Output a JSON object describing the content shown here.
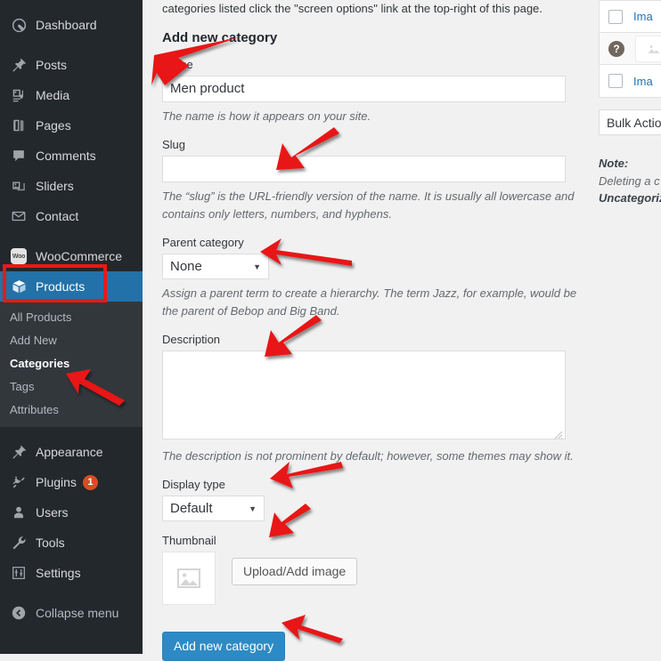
{
  "sidebar": {
    "items": [
      {
        "label": "Dashboard",
        "icon": "dashboard-icon",
        "name": "dashboard"
      },
      {
        "label": "Posts",
        "icon": "pin-icon",
        "name": "posts"
      },
      {
        "label": "Media",
        "icon": "media-icon",
        "name": "media"
      },
      {
        "label": "Pages",
        "icon": "pages-icon",
        "name": "pages"
      },
      {
        "label": "Comments",
        "icon": "comment-icon",
        "name": "comments"
      },
      {
        "label": "Sliders",
        "icon": "sliders-icon",
        "name": "sliders"
      },
      {
        "label": "Contact",
        "icon": "envelope-icon",
        "name": "contact"
      },
      {
        "label": "WooCommerce",
        "icon": "woocommerce-icon",
        "name": "woocommerce"
      },
      {
        "label": "Products",
        "icon": "product-box-icon",
        "name": "products",
        "current": true
      },
      {
        "label": "Appearance",
        "icon": "brush-icon",
        "name": "appearance"
      },
      {
        "label": "Plugins",
        "icon": "plug-icon",
        "name": "plugins",
        "badge": "1"
      },
      {
        "label": "Users",
        "icon": "user-icon",
        "name": "users"
      },
      {
        "label": "Tools",
        "icon": "wrench-icon",
        "name": "tools"
      },
      {
        "label": "Settings",
        "icon": "settings-sliders-icon",
        "name": "settings"
      },
      {
        "label": "Collapse menu",
        "icon": "collapse-arrow-icon",
        "name": "collapse-menu"
      }
    ],
    "submenu": [
      {
        "label": "All Products",
        "active": false
      },
      {
        "label": "Add New",
        "active": false
      },
      {
        "label": "Categories",
        "active": true
      },
      {
        "label": "Tags",
        "active": false
      },
      {
        "label": "Attributes",
        "active": false
      }
    ],
    "woo_badge_text": "Woo",
    "plugins_badge": "1"
  },
  "main": {
    "intro": "categories listed click the \"screen options\" link at the top-right of this page.",
    "form_title": "Add new category",
    "fields": {
      "name": {
        "label": "Name",
        "value": "Men product",
        "description": "The name is how it appears on your site."
      },
      "slug": {
        "label": "Slug",
        "value": "",
        "description": "The “slug” is the URL-friendly version of the name. It is usually all lowercase and contains only letters, numbers, and hyphens."
      },
      "parent": {
        "label": "Parent category",
        "value": "None",
        "options": [
          "None"
        ],
        "description": "Assign a parent term to create a hierarchy. The term Jazz, for example, would be the parent of Bebop and Big Band."
      },
      "description": {
        "label": "Description",
        "value": "",
        "description": "The description is not prominent by default; however, some themes may show it."
      },
      "display_type": {
        "label": "Display type",
        "value": "Default",
        "options": [
          "Default"
        ]
      },
      "thumbnail": {
        "label": "Thumbnail",
        "upload_button": "Upload/Add image",
        "placeholder_icon": "image-placeholder-icon"
      }
    },
    "submit_button": "Add new category"
  },
  "right_panel": {
    "rows": [
      {
        "type": "checkbox",
        "text": "Ima",
        "checked": false,
        "alt": false
      },
      {
        "type": "help",
        "icon": "question-mark-icon",
        "thumb_icon": "image-placeholder-icon",
        "alt": true
      },
      {
        "type": "checkbox",
        "text": "Ima",
        "checked": false,
        "alt": false
      }
    ],
    "bulk_actions": "Bulk Actio",
    "note": {
      "heading": "Note:",
      "line1": "Deleting a c…",
      "line2": "Uncategoriz…"
    }
  },
  "annotations": {
    "highlight_color": "#e81919",
    "arrow_count": 8,
    "highlight_box": "products-menu-item"
  }
}
